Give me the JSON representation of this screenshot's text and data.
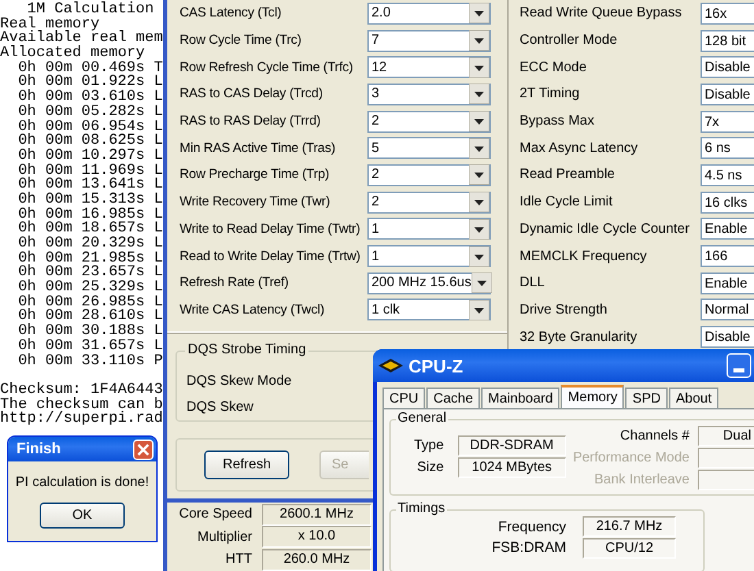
{
  "console": {
    "lines": [
      {
        "kind": "heading",
        "text": "1M Calculation"
      },
      {
        "kind": "plain",
        "text": "Real memory"
      },
      {
        "kind": "plain",
        "text": "Available real mem"
      },
      {
        "kind": "plain",
        "text": "Allocated memory"
      },
      {
        "kind": "time",
        "text": "0h 00m 00.469s T"
      },
      {
        "kind": "time",
        "text": "0h 00m 01.922s L"
      },
      {
        "kind": "time",
        "text": "0h 00m 03.610s L"
      },
      {
        "kind": "time",
        "text": "0h 00m 05.282s L"
      },
      {
        "kind": "time",
        "text": "0h 00m 06.954s L"
      },
      {
        "kind": "time",
        "text": "0h 00m 08.625s L"
      },
      {
        "kind": "time",
        "text": "0h 00m 10.297s L"
      },
      {
        "kind": "time",
        "text": "0h 00m 11.969s L"
      },
      {
        "kind": "time",
        "text": "0h 00m 13.641s L"
      },
      {
        "kind": "time",
        "text": "0h 00m 15.313s L"
      },
      {
        "kind": "time",
        "text": "0h 00m 16.985s L"
      },
      {
        "kind": "time",
        "text": "0h 00m 18.657s L"
      },
      {
        "kind": "time",
        "text": "0h 00m 20.329s L"
      },
      {
        "kind": "time",
        "text": "0h 00m 21.985s L"
      },
      {
        "kind": "time",
        "text": "0h 00m 23.657s L"
      },
      {
        "kind": "time",
        "text": "0h 00m 25.329s L"
      },
      {
        "kind": "time",
        "text": "0h 00m 26.985s L"
      },
      {
        "kind": "time",
        "text": "0h 00m 28.610s L"
      },
      {
        "kind": "time",
        "text": "0h 00m 30.188s L"
      },
      {
        "kind": "time",
        "text": "0h 00m 31.657s L"
      },
      {
        "kind": "time",
        "text": "0h 00m 33.110s P"
      },
      {
        "kind": "blank"
      },
      {
        "kind": "plain",
        "text": "Checksum: 1F4A6443"
      },
      {
        "kind": "plain",
        "text": "The checksum can b"
      },
      {
        "kind": "plain",
        "text": "http://superpi.rad"
      }
    ]
  },
  "finish_dialog": {
    "title": "Finish",
    "message": "PI calculation is done!",
    "button": "OK"
  },
  "timings_panel": {
    "settings": [
      {
        "label": "CAS Latency (Tcl)",
        "value": "2.0"
      },
      {
        "label": "Row Cycle Time (Trc)",
        "value": "7"
      },
      {
        "label": "Row Refresh Cycle Time (Trfc)",
        "value": "12"
      },
      {
        "label": "RAS to CAS Delay (Trcd)",
        "value": "3"
      },
      {
        "label": "RAS to RAS Delay (Trrd)",
        "value": "2"
      },
      {
        "label": "Min RAS Active Time (Tras)",
        "value": "5"
      },
      {
        "label": "Row Precharge Time (Trp)",
        "value": "2"
      },
      {
        "label": "Write Recovery Time (Twr)",
        "value": "2"
      },
      {
        "label": "Write to Read Delay Time (Twtr)",
        "value": "1"
      },
      {
        "label": "Read to Write Delay Time (Trtw)",
        "value": "1"
      },
      {
        "label": "Refresh Rate (Tref)",
        "value": "200 MHz 15.6us"
      },
      {
        "label": "Write CAS Latency (Twcl)",
        "value": "1 clk"
      }
    ],
    "dqs_group": {
      "title": "DQS Strobe Timing",
      "settings": [
        {
          "label": "DQS Skew Mode"
        },
        {
          "label": "DQS Skew"
        }
      ]
    },
    "buttons": [
      {
        "label": "Refresh",
        "disabled": false
      },
      {
        "label": "Se",
        "disabled": true
      }
    ]
  },
  "cpu_info": [
    {
      "label": "Core Speed",
      "value": "2600.1 MHz"
    },
    {
      "label": "Multiplier",
      "value": "x 10.0"
    },
    {
      "label": "HTT",
      "value": "260.0 MHz"
    }
  ],
  "controller_panel": {
    "settings": [
      {
        "label": "Read Write Queue Bypass",
        "value": "16x"
      },
      {
        "label": "Controller Mode",
        "value": "128 bit"
      },
      {
        "label": "ECC Mode",
        "value": "Disable"
      },
      {
        "label": "2T Timing",
        "value": "Disable"
      },
      {
        "label": "Bypass Max",
        "value": "7x"
      },
      {
        "label": "Max Async Latency",
        "value": "6 ns"
      },
      {
        "label": "Read Preamble",
        "value": "4.5 ns"
      },
      {
        "label": "Idle Cycle Limit",
        "value": "16 clks"
      },
      {
        "label": "Dynamic Idle Cycle Counter",
        "value": "Enable"
      },
      {
        "label": "MEMCLK Frequency",
        "value": "166"
      },
      {
        "label": "DLL",
        "value": "Enable"
      },
      {
        "label": "Drive Strength",
        "value": "Normal"
      },
      {
        "label": "32 Byte Granularity",
        "value": "Disable"
      }
    ]
  },
  "cpuz": {
    "title": "CPU-Z",
    "tabs": [
      {
        "label": "CPU",
        "selected": false
      },
      {
        "label": "Cache",
        "selected": false
      },
      {
        "label": "Mainboard",
        "selected": false
      },
      {
        "label": "Memory",
        "selected": true
      },
      {
        "label": "SPD",
        "selected": false
      },
      {
        "label": "About",
        "selected": false
      }
    ],
    "general": {
      "title": "General",
      "memory_fields": [
        {
          "label": "Type",
          "value": "DDR-SDRAM"
        },
        {
          "label": "Size",
          "value": "1024 MBytes"
        }
      ],
      "channel_fields": [
        {
          "label": "Channels #",
          "value": "Dual",
          "disabled": false
        },
        {
          "label": "Performance Mode",
          "disabled": true
        },
        {
          "label": "Bank Interleave",
          "disabled": true
        }
      ]
    },
    "timings": {
      "title": "Timings",
      "fields": [
        {
          "label": "Frequency",
          "value": "216.7 MHz"
        },
        {
          "label": "FSB:DRAM",
          "value": "CPU/12"
        }
      ]
    }
  }
}
